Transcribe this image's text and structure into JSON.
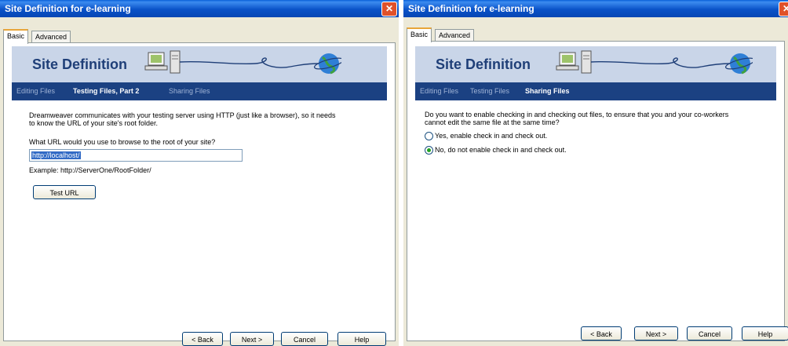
{
  "colors": {
    "title_bar": "#0a52c8",
    "banner": "#c9d5e8",
    "nav_bar": "#1b4182",
    "selection": "#316ac5",
    "close": "#e0512a"
  },
  "left_dialog": {
    "title": "Site Definition for e-learning",
    "tabs": [
      "Basic",
      "Advanced"
    ],
    "active_tab": "Basic",
    "banner_title": "Site Definition",
    "steps": [
      "Editing Files",
      "Testing Files, Part 2",
      "Sharing Files"
    ],
    "current_step": "Testing Files, Part 2",
    "description_line1": "Dreamweaver communicates with your testing server using HTTP (just like a browser), so it needs",
    "description_line2": "to know the URL of your site's root folder.",
    "question": "What URL would you use to browse to the root of your site?",
    "url_value": "http://localhost/",
    "example": "Example: http://ServerOne/RootFolder/",
    "test_button": "Test URL",
    "buttons": {
      "back": "< Back",
      "next": "Next >",
      "cancel": "Cancel",
      "help": "Help"
    }
  },
  "right_dialog": {
    "title": "Site Definition for e-learning",
    "tabs": [
      "Basic",
      "Advanced"
    ],
    "active_tab": "Basic",
    "banner_title": "Site Definition",
    "steps": [
      "Editing Files",
      "Testing Files",
      "Sharing Files"
    ],
    "current_step": "Sharing Files",
    "question_line1": "Do you want to enable checking in and checking out files, to ensure that you and your co-workers",
    "question_line2": "cannot edit the same file at the same time?",
    "options": [
      "Yes, enable check in and check out.",
      "No, do not enable check in and check out."
    ],
    "selected_option": "No, do not enable check in and check out.",
    "buttons": {
      "back": "< Back",
      "next": "Next >",
      "cancel": "Cancel",
      "help": "Help"
    }
  }
}
